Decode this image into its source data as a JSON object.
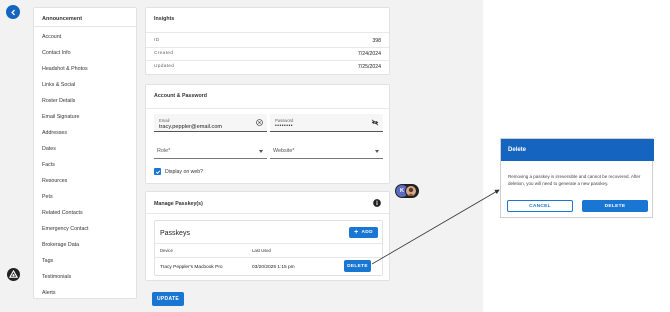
{
  "sidebar": {
    "header": "Announcement",
    "items": [
      "Account",
      "Contact Info",
      "Headshot & Photos",
      "Links & Social",
      "Roster Details",
      "Email Signature",
      "Addresses",
      "Dates",
      "Facts",
      "Resources",
      "Pets",
      "Related Contacts",
      "Emergency Contact",
      "Brokerage Data",
      "Tags",
      "Testimonials",
      "Alerts"
    ]
  },
  "insights": {
    "title": "Insights",
    "rows": [
      {
        "label": "ID",
        "value": "398"
      },
      {
        "label": "Created",
        "value": "7/24/2024"
      },
      {
        "label": "Updated",
        "value": "7/25/2024"
      }
    ]
  },
  "account": {
    "title": "Account & Password",
    "email_label": "Email",
    "email_value": "tracy.peppler@email.com",
    "password_label": "Password",
    "password_value": "••••••••",
    "role_placeholder": "Role*",
    "website_placeholder": "Website*",
    "display_on_web_label": "Display on web?",
    "display_on_web_checked": true
  },
  "passkeys": {
    "title": "Manage Passkey(s)",
    "inner_title": "Passkeys",
    "add_label": "ADD",
    "columns": [
      "Device",
      "Last Used"
    ],
    "rows": [
      {
        "device": "Tracy Peppler's Macbook Pro",
        "last_used": "03/20/2025 1:15 pm",
        "action": "DELETE"
      }
    ]
  },
  "update_label": "UPDATE",
  "avatar_initial": "K",
  "dialog": {
    "title": "Delete",
    "text": "Removing a passkey is irreversible and cannot be recovered. After deletion, you will need to generate a new passkey.",
    "cancel_label": "CANCEL",
    "delete_label": "DELETE"
  },
  "colors": {
    "primary": "#1976d2",
    "dialog_header": "#1565c0",
    "background": "#f2f2f2"
  }
}
